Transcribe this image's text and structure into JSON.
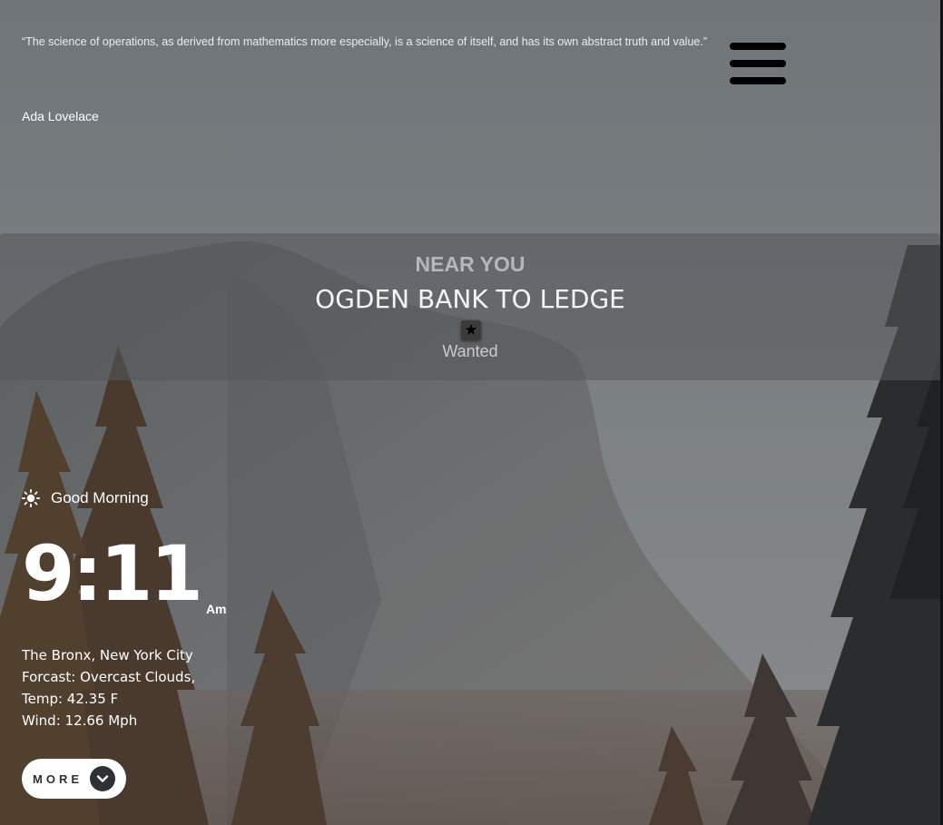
{
  "quote": {
    "text": "“The science of operations, as derived from mathematics more especially, is a science of itself, and has its own abstract truth and value.”",
    "author": "Ada Lovelace"
  },
  "menu": {
    "icon": "hamburger-menu-icon"
  },
  "near_you": {
    "heading": "NEAR YOU",
    "place": "OGDEN BANK TO LEDGE",
    "status_icon": "star-icon",
    "status": "Wanted"
  },
  "greeting": {
    "icon": "sun-icon",
    "text": "Good Morning"
  },
  "clock": {
    "time": "9:11",
    "period": "Am"
  },
  "weather": {
    "location": "The Bronx, New York City",
    "forecast": "Forcast: Overcast Clouds,",
    "temp": "Temp: 42.35 F",
    "wind": "Wind: 12.66 Mph"
  },
  "more_button": {
    "label": "MORE",
    "icon": "chevron-down-icon"
  },
  "colors": {
    "panel": "#55585b",
    "menu_icon": "#000000",
    "more_button_bg": "#ffffff",
    "more_chevron_bg": "#2f3235"
  }
}
